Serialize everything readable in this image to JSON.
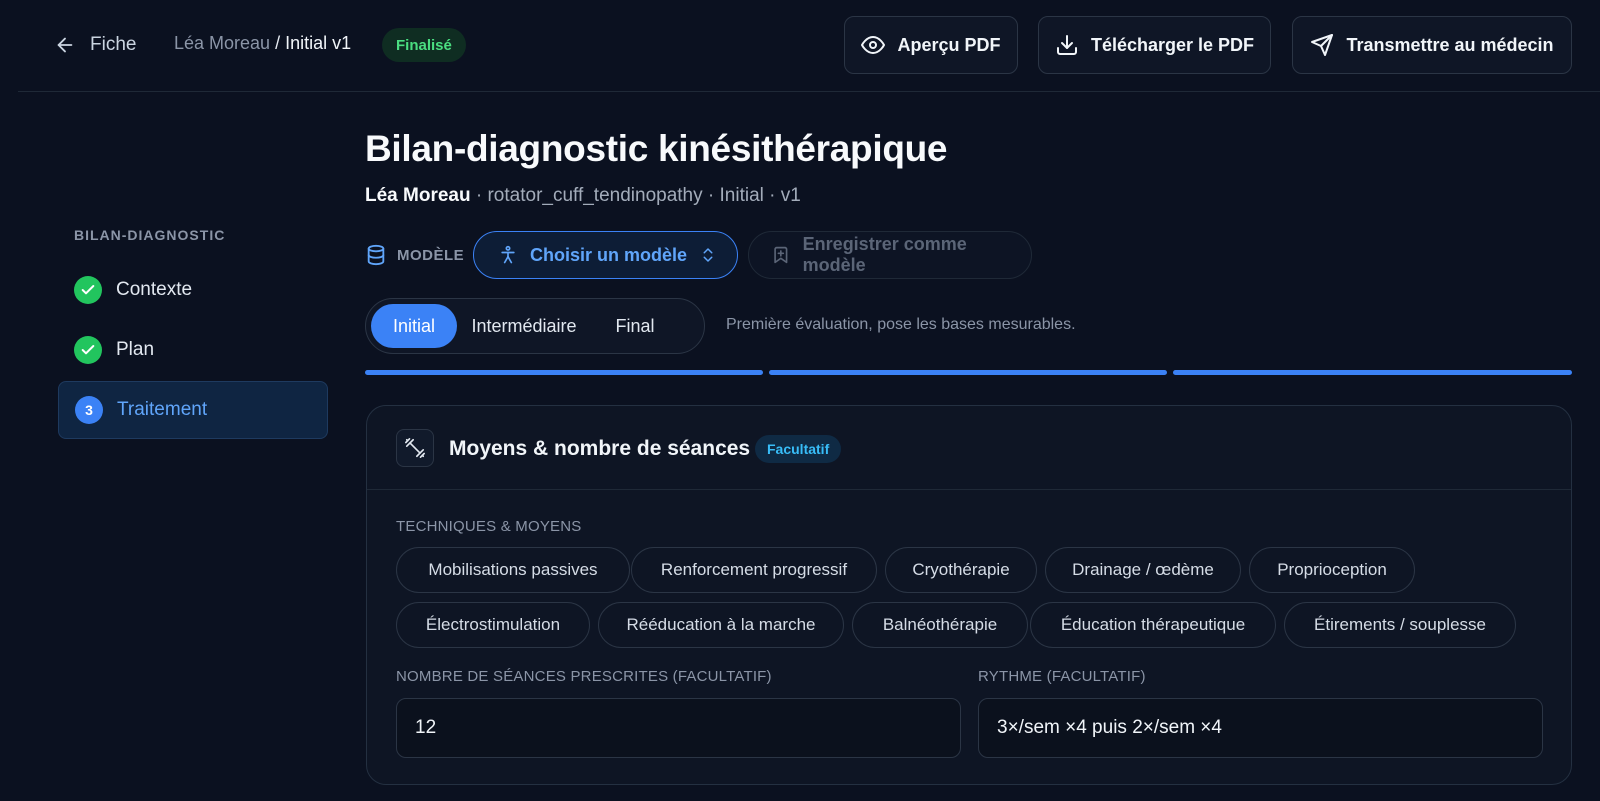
{
  "header": {
    "back_label": "Fiche",
    "breadcrumb_patient": "Léa Moreau",
    "breadcrumb_sep": " / ",
    "breadcrumb_current": "Initial v1",
    "status_badge": "Finalisé",
    "actions": {
      "preview_pdf": "Aperçu PDF",
      "download_pdf": "Télécharger le PDF",
      "send_doctor": "Transmettre au médecin"
    }
  },
  "sidebar": {
    "title": "BILAN-DIAGNOSTIC",
    "steps": [
      {
        "label": "Contexte",
        "state": "done"
      },
      {
        "label": "Plan",
        "state": "done"
      },
      {
        "label": "Traitement",
        "state": "active",
        "number": "3"
      }
    ]
  },
  "main": {
    "title": "Bilan-diagnostic kinésithérapique",
    "subtitle_patient": "Léa Moreau",
    "subtitle_rest": " · rotator_cuff_tendinopathy · Initial · v1",
    "model_label": "MODÈLE",
    "choose_model": "Choisir un modèle",
    "save_as_model": "Enregistrer comme modèle",
    "phases": [
      "Initial",
      "Intermédiaire",
      "Final"
    ],
    "active_phase": "Initial",
    "phase_hint": "Première évaluation, pose les bases mesurables.",
    "progress_segments_complete": 3
  },
  "card": {
    "title": "Moyens & nombre de séances",
    "badge": "Facultatif",
    "techniques_label": "TECHNIQUES & MOYENS",
    "techniques": [
      "Mobilisations passives",
      "Renforcement progressif",
      "Cryothérapie",
      "Drainage / œdème",
      "Proprioception",
      "Électrostimulation",
      "Rééducation à la marche",
      "Balnéothérapie",
      "Éducation thérapeutique",
      "Étirements / souplesse"
    ],
    "sessions_label": "NOMBRE DE SÉANCES PRESCRITES (FACULTATIF)",
    "sessions_value": "12",
    "rhythm_label": "RYTHME (FACULTATIF)",
    "rhythm_value": "3×/sem ×4 puis 2×/sem ×4"
  },
  "colors": {
    "accent": "#3b82f6",
    "success": "#22c55e",
    "background": "#0b1120"
  }
}
